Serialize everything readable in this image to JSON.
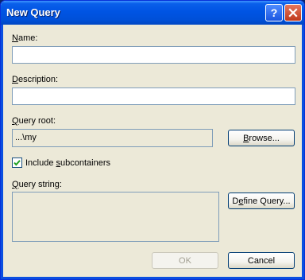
{
  "window": {
    "title": "New Query"
  },
  "name": {
    "label_first": "N",
    "label_rest": "ame:",
    "value": "",
    "placeholder": ""
  },
  "description": {
    "label_first": "D",
    "label_rest": "escription:",
    "value": "",
    "placeholder": ""
  },
  "query_root": {
    "label_first": "Q",
    "label_rest": "uery root:",
    "value": "...\\my",
    "browse_first": "B",
    "browse_rest": "rowse..."
  },
  "include_subcontainers": {
    "label_pre": "Include ",
    "label_key": "s",
    "label_post": "ubcontainers",
    "checked": true
  },
  "query_string": {
    "label_first": "Q",
    "label_rest": "uery string:",
    "value": "",
    "define_pre": "D",
    "define_key": "e",
    "define_post": "fine Query..."
  },
  "buttons": {
    "ok": "OK",
    "cancel": "Cancel",
    "ok_enabled": false
  },
  "icons": {
    "help": "help-icon",
    "close": "close-icon",
    "check": "checkmark-icon"
  },
  "colors": {
    "titlebar": "#0054e3",
    "dialog_bg": "#ece9d8",
    "field_border": "#7f9db9",
    "check_green": "#21a121"
  }
}
